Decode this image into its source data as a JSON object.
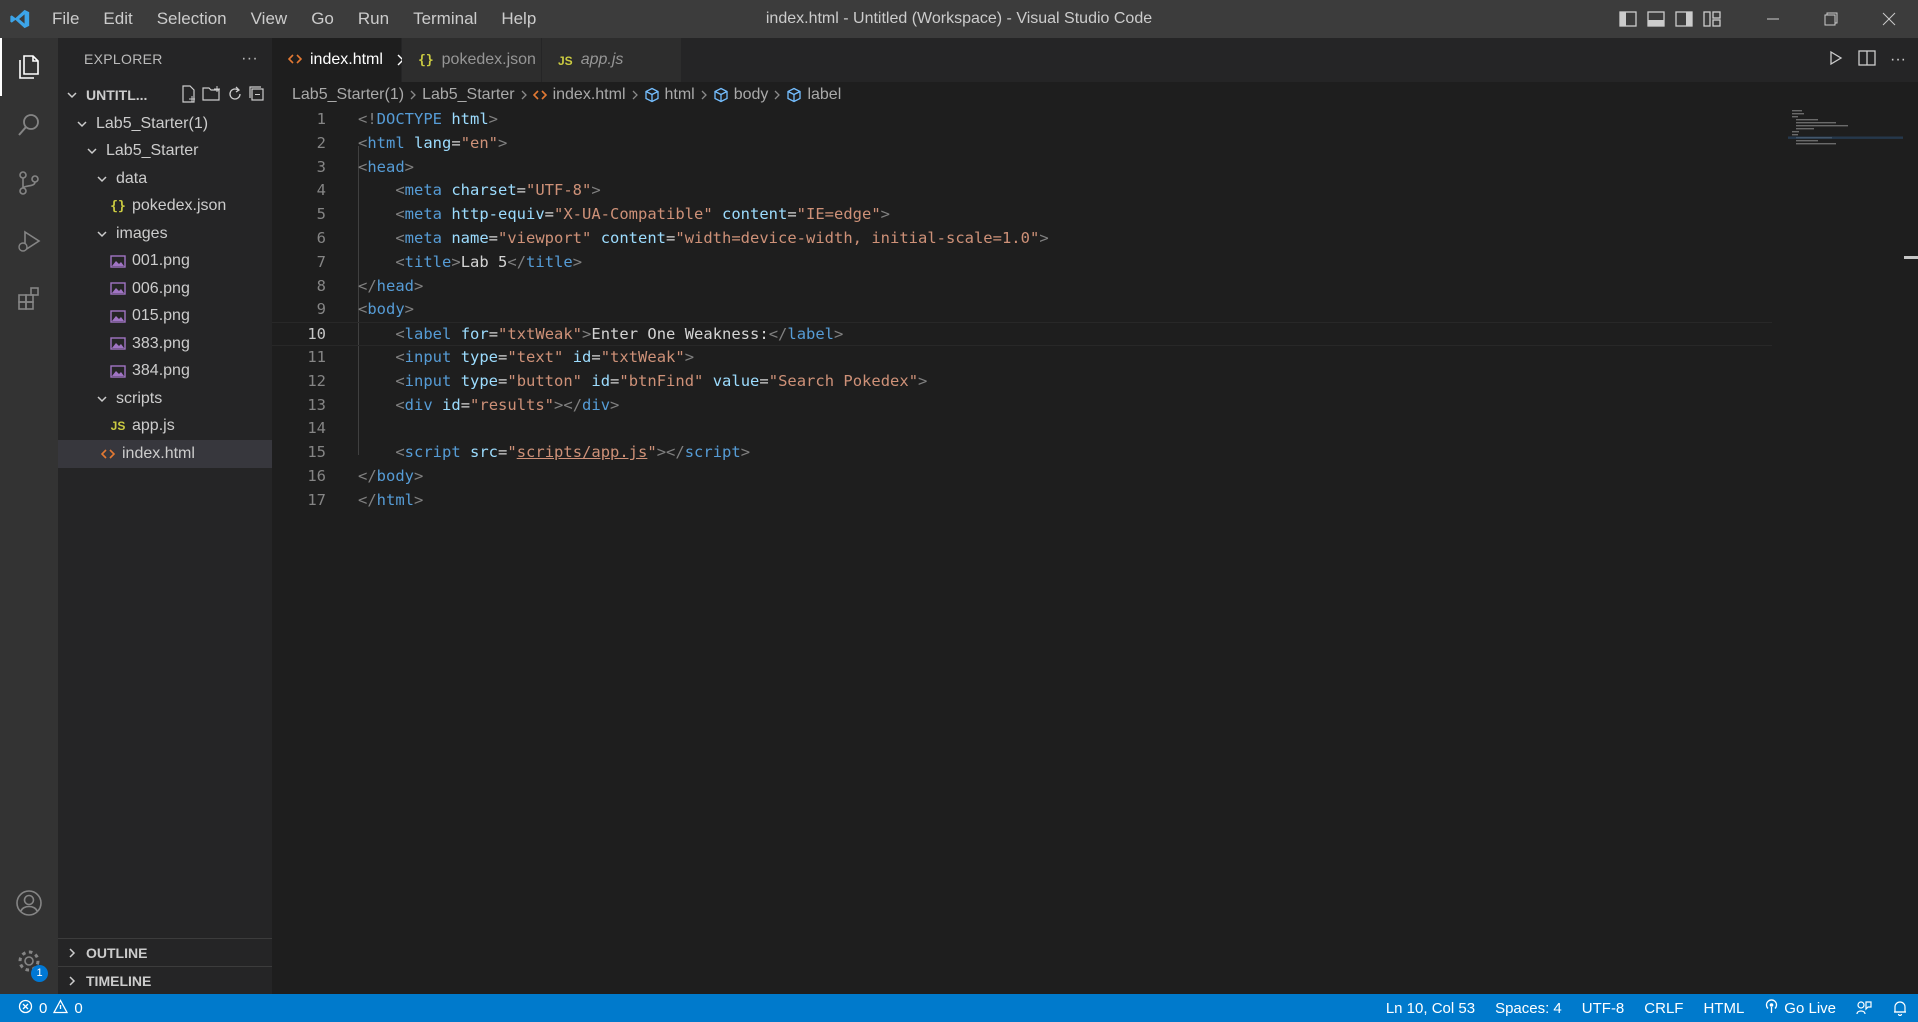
{
  "window": {
    "title": "index.html - Untitled (Workspace) - Visual Studio Code",
    "menu": [
      "File",
      "Edit",
      "Selection",
      "View",
      "Go",
      "Run",
      "Terminal",
      "Help"
    ],
    "accent": "#007acc"
  },
  "activity": {
    "items": [
      "files-icon",
      "search-icon",
      "source-control-icon",
      "run-debug-icon",
      "extensions-icon"
    ],
    "bottom": [
      "account-icon",
      "manage-gear-icon"
    ],
    "manage_badge": "1"
  },
  "sidebar": {
    "title": "EXPLORER",
    "more": "···",
    "workspace": "UNTITL...",
    "tree": [
      {
        "label": "Lab5_Starter(1)",
        "type": "folder",
        "depth": 1
      },
      {
        "label": "Lab5_Starter",
        "type": "folder",
        "depth": 2
      },
      {
        "label": "data",
        "type": "folder",
        "depth": 3
      },
      {
        "label": "pokedex.json",
        "type": "json",
        "depth": 4
      },
      {
        "label": "images",
        "type": "folder",
        "depth": 3
      },
      {
        "label": "001.png",
        "type": "image",
        "depth": 4
      },
      {
        "label": "006.png",
        "type": "image",
        "depth": 4
      },
      {
        "label": "015.png",
        "type": "image",
        "depth": 4
      },
      {
        "label": "383.png",
        "type": "image",
        "depth": 4
      },
      {
        "label": "384.png",
        "type": "image",
        "depth": 4
      },
      {
        "label": "scripts",
        "type": "folder",
        "depth": 3
      },
      {
        "label": "app.js",
        "type": "js",
        "depth": 4
      },
      {
        "label": "index.html",
        "type": "html",
        "depth": 3,
        "selected": true
      }
    ],
    "outline": "OUTLINE",
    "timeline": "TIMELINE"
  },
  "editor": {
    "tabs": [
      {
        "label": "index.html",
        "icon": "html",
        "active": true
      },
      {
        "label": "pokedex.json",
        "icon": "json",
        "active": false
      },
      {
        "label": "app.js",
        "icon": "js",
        "active": false,
        "italic": true
      }
    ],
    "breadcrumb": [
      "Lab5_Starter(1)",
      "Lab5_Starter",
      "index.html",
      "html",
      "body",
      "label"
    ],
    "current_line": 10,
    "lines": [
      [
        [
          "br",
          "<!"
        ],
        [
          "tag",
          "DOCTYPE"
        ],
        [
          "txt",
          " "
        ],
        [
          "attr",
          "html"
        ],
        [
          "br",
          ">"
        ]
      ],
      [
        [
          "br",
          "<"
        ],
        [
          "tag",
          "html"
        ],
        [
          "txt",
          " "
        ],
        [
          "attr",
          "lang"
        ],
        [
          "txt",
          "="
        ],
        [
          "str",
          "\"en\""
        ],
        [
          "br",
          ">"
        ]
      ],
      [
        [
          "br",
          "<"
        ],
        [
          "tag",
          "head"
        ],
        [
          "br",
          ">"
        ]
      ],
      [
        [
          "txt",
          "    "
        ],
        [
          "br",
          "<"
        ],
        [
          "tag",
          "meta"
        ],
        [
          "txt",
          " "
        ],
        [
          "attr",
          "charset"
        ],
        [
          "txt",
          "="
        ],
        [
          "str",
          "\"UTF-8\""
        ],
        [
          "br",
          ">"
        ]
      ],
      [
        [
          "txt",
          "    "
        ],
        [
          "br",
          "<"
        ],
        [
          "tag",
          "meta"
        ],
        [
          "txt",
          " "
        ],
        [
          "attr",
          "http-equiv"
        ],
        [
          "txt",
          "="
        ],
        [
          "str",
          "\"X-UA-Compatible\""
        ],
        [
          "txt",
          " "
        ],
        [
          "attr",
          "content"
        ],
        [
          "txt",
          "="
        ],
        [
          "str",
          "\"IE=edge\""
        ],
        [
          "br",
          ">"
        ]
      ],
      [
        [
          "txt",
          "    "
        ],
        [
          "br",
          "<"
        ],
        [
          "tag",
          "meta"
        ],
        [
          "txt",
          " "
        ],
        [
          "attr",
          "name"
        ],
        [
          "txt",
          "="
        ],
        [
          "str",
          "\"viewport\""
        ],
        [
          "txt",
          " "
        ],
        [
          "attr",
          "content"
        ],
        [
          "txt",
          "="
        ],
        [
          "str",
          "\"width=device-width, initial-scale=1.0\""
        ],
        [
          "br",
          ">"
        ]
      ],
      [
        [
          "txt",
          "    "
        ],
        [
          "br",
          "<"
        ],
        [
          "tag",
          "title"
        ],
        [
          "br",
          ">"
        ],
        [
          "txt",
          "Lab 5"
        ],
        [
          "br",
          "</"
        ],
        [
          "tag",
          "title"
        ],
        [
          "br",
          ">"
        ]
      ],
      [
        [
          "br",
          "</"
        ],
        [
          "tag",
          "head"
        ],
        [
          "br",
          ">"
        ]
      ],
      [
        [
          "br",
          "<"
        ],
        [
          "tag",
          "body"
        ],
        [
          "br",
          ">"
        ]
      ],
      [
        [
          "txt",
          "    "
        ],
        [
          "br",
          "<"
        ],
        [
          "tag",
          "label"
        ],
        [
          "txt",
          " "
        ],
        [
          "attr",
          "for"
        ],
        [
          "txt",
          "="
        ],
        [
          "str",
          "\"txtWeak\""
        ],
        [
          "br",
          ">"
        ],
        [
          "txt",
          "Enter One Weakness:"
        ],
        [
          "br",
          "</"
        ],
        [
          "tag",
          "label"
        ],
        [
          "br",
          ">"
        ]
      ],
      [
        [
          "txt",
          "    "
        ],
        [
          "br",
          "<"
        ],
        [
          "tag",
          "input"
        ],
        [
          "txt",
          " "
        ],
        [
          "attr",
          "type"
        ],
        [
          "txt",
          "="
        ],
        [
          "str",
          "\"text\""
        ],
        [
          "txt",
          " "
        ],
        [
          "attr",
          "id"
        ],
        [
          "txt",
          "="
        ],
        [
          "str",
          "\"txtWeak\""
        ],
        [
          "br",
          ">"
        ]
      ],
      [
        [
          "txt",
          "    "
        ],
        [
          "br",
          "<"
        ],
        [
          "tag",
          "input"
        ],
        [
          "txt",
          " "
        ],
        [
          "attr",
          "type"
        ],
        [
          "txt",
          "="
        ],
        [
          "str",
          "\"button\""
        ],
        [
          "txt",
          " "
        ],
        [
          "attr",
          "id"
        ],
        [
          "txt",
          "="
        ],
        [
          "str",
          "\"btnFind\""
        ],
        [
          "txt",
          " "
        ],
        [
          "attr",
          "value"
        ],
        [
          "txt",
          "="
        ],
        [
          "str",
          "\"Search Pokedex\""
        ],
        [
          "br",
          ">"
        ]
      ],
      [
        [
          "txt",
          "    "
        ],
        [
          "br",
          "<"
        ],
        [
          "tag",
          "div"
        ],
        [
          "txt",
          " "
        ],
        [
          "attr",
          "id"
        ],
        [
          "txt",
          "="
        ],
        [
          "str",
          "\"results\""
        ],
        [
          "br",
          "></"
        ],
        [
          "tag",
          "div"
        ],
        [
          "br",
          ">"
        ]
      ],
      [],
      [
        [
          "txt",
          "    "
        ],
        [
          "br",
          "<"
        ],
        [
          "tag",
          "script"
        ],
        [
          "txt",
          " "
        ],
        [
          "attr",
          "src"
        ],
        [
          "txt",
          "="
        ],
        [
          "str",
          "\""
        ],
        [
          "link",
          "scripts/app.js"
        ],
        [
          "str",
          "\""
        ],
        [
          "br",
          "></"
        ],
        [
          "tag",
          "script"
        ],
        [
          "br",
          ">"
        ]
      ],
      [
        [
          "br",
          "</"
        ],
        [
          "tag",
          "body"
        ],
        [
          "br",
          ">"
        ]
      ],
      [
        [
          "br",
          "</"
        ],
        [
          "tag",
          "html"
        ],
        [
          "br",
          ">"
        ]
      ]
    ]
  },
  "status": {
    "errors": "0",
    "warnings": "0",
    "position": "Ln 10, Col 53",
    "spaces": "Spaces: 4",
    "encoding": "UTF-8",
    "eol": "CRLF",
    "language": "HTML",
    "golive": "Go Live"
  }
}
